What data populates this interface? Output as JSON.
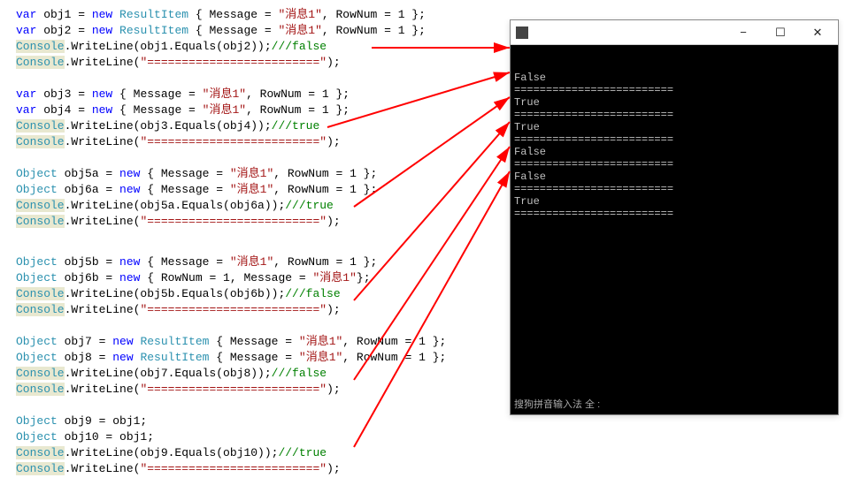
{
  "code": {
    "block1": {
      "l1_a": "var",
      "l1_b": " obj1 = ",
      "l1_c": "new",
      "l1_d": " ResultItem ",
      "l1_e": "{ Message = ",
      "l1_f": "\"消息1\"",
      "l1_g": ", RowNum = 1 };",
      "l2_a": "var",
      "l2_b": " obj2 = ",
      "l2_c": "new",
      "l2_d": " ResultItem ",
      "l2_e": "{ Message = ",
      "l2_f": "\"消息1\"",
      "l2_g": ", RowNum = 1 };",
      "l3_a": "Console",
      "l3_b": ".WriteLine(obj1.Equals(obj2));",
      "l3_c": "///false",
      "l4_a": "Console",
      "l4_b": ".WriteLine(",
      "l4_c": "\"=========================\"",
      "l4_d": ");"
    },
    "block2": {
      "l1_a": "var",
      "l1_b": " obj3 = ",
      "l1_c": "new",
      "l1_d": " { Message = ",
      "l1_e": "\"消息1\"",
      "l1_f": ", RowNum = 1 };",
      "l2_a": "var",
      "l2_b": " obj4 = ",
      "l2_c": "new",
      "l2_d": " { Message = ",
      "l2_e": "\"消息1\"",
      "l2_f": ", RowNum = 1 };",
      "l3_a": "Console",
      "l3_b": ".WriteLine(obj3.Equals(obj4));",
      "l3_c": "///true",
      "l4_a": "Console",
      "l4_b": ".WriteLine(",
      "l4_c": "\"=========================\"",
      "l4_d": ");"
    },
    "block3": {
      "l1_a": "Object",
      "l1_b": " obj5a = ",
      "l1_c": "new",
      "l1_d": " { Message = ",
      "l1_e": "\"消息1\"",
      "l1_f": ", RowNum = 1 };",
      "l2_a": "Object",
      "l2_b": " obj6a = ",
      "l2_c": "new",
      "l2_d": " { Message = ",
      "l2_e": "\"消息1\"",
      "l2_f": ", RowNum = 1 };",
      "l3_a": "Console",
      "l3_b": ".WriteLine(obj5a.Equals(obj6a));",
      "l3_c": "///true",
      "l4_a": "Console",
      "l4_b": ".WriteLine(",
      "l4_c": "\"=========================\"",
      "l4_d": ");"
    },
    "block4": {
      "l1_a": "Object",
      "l1_b": " obj5b = ",
      "l1_c": "new",
      "l1_d": " { Message = ",
      "l1_e": "\"消息1\"",
      "l1_f": ", RowNum = 1 };",
      "l2_a": "Object",
      "l2_b": " obj6b = ",
      "l2_c": "new",
      "l2_d": " { RowNum = 1, Message = ",
      "l2_e": "\"消息1\"",
      "l2_f": "};",
      "l3_a": "Console",
      "l3_b": ".WriteLine(obj5b.Equals(obj6b));",
      "l3_c": "///false",
      "l4_a": "Console",
      "l4_b": ".WriteLine(",
      "l4_c": "\"=========================\"",
      "l4_d": ");"
    },
    "block5": {
      "l1_a": "Object",
      "l1_b": " obj7 = ",
      "l1_c": "new",
      "l1_d": " ResultItem ",
      "l1_e": "{ Message = ",
      "l1_f": "\"消息1\"",
      "l1_g": ", RowNum = 1 };",
      "l2_a": "Object",
      "l2_b": " obj8 = ",
      "l2_c": "new",
      "l2_d": " ResultItem ",
      "l2_e": "{ Message = ",
      "l2_f": "\"消息1\"",
      "l2_g": ", RowNum = 1 };",
      "l3_a": "Console",
      "l3_b": ".WriteLine(obj7.Equals(obj8));",
      "l3_c": "///false",
      "l4_a": "Console",
      "l4_b": ".WriteLine(",
      "l4_c": "\"=========================\"",
      "l4_d": ");"
    },
    "block6": {
      "l1_a": "Object",
      "l1_b": " obj9 = obj1;",
      "l2_a": "Object",
      "l2_b": " obj10 = obj1;",
      "l3_a": "Console",
      "l3_b": ".WriteLine(obj9.Equals(obj10));",
      "l3_c": "///true",
      "l4_a": "Console",
      "l4_b": ".WriteLine(",
      "l4_c": "\"=========================\"",
      "l4_d": ");"
    }
  },
  "console": {
    "title": "",
    "output": "False\n=========================\nTrue\n=========================\nTrue\n=========================\nFalse\n=========================\nFalse\n=========================\nTrue\n=========================",
    "ime": "搜狗拼音输入法 全 :"
  },
  "titlebar": {
    "min": "−",
    "max": "☐",
    "close": "✕"
  }
}
